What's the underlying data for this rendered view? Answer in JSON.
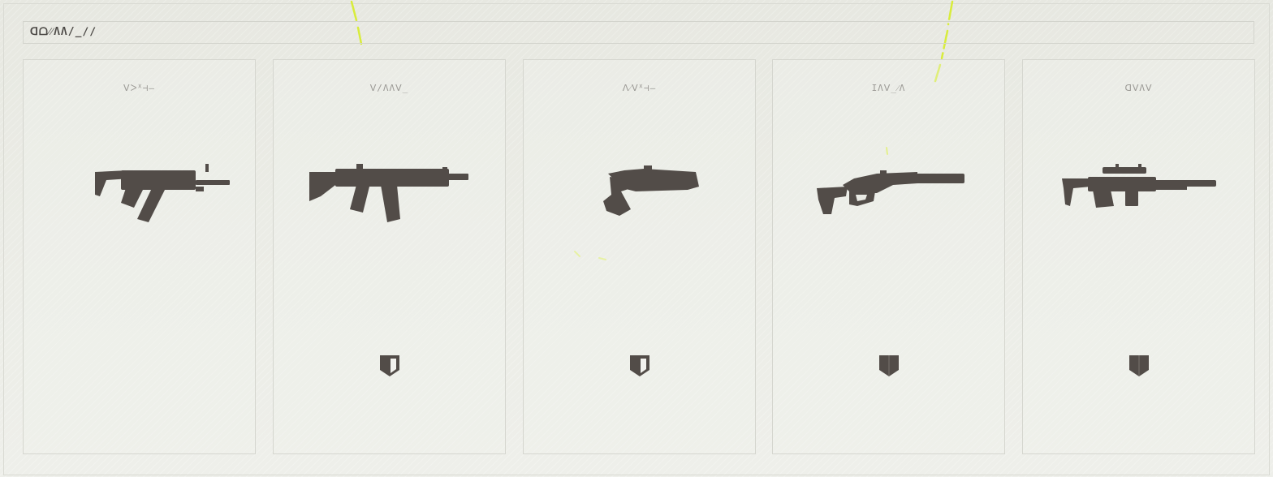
{
  "header": {
    "title_glyph": "ᗡᗝ⁄⁄ΛΛ/_∕∕"
  },
  "cards": [
    {
      "label": "ᐯᐳᕁ⊣–",
      "weapon": "smg-icon",
      "shield": "none"
    },
    {
      "label": "ᐯ/ΛΛᐯ_",
      "weapon": "assault-rifle-icon",
      "shield": "half"
    },
    {
      "label": "ᐱ⁄ᐯᕁ⊣–",
      "weapon": "pistol-icon",
      "shield": "half"
    },
    {
      "label": "ΙΛᐯ_⁄Λ",
      "weapon": "bolt-rifle-icon",
      "shield": "full"
    },
    {
      "label": "ᗡᐯΛᐯ",
      "weapon": "sniper-rifle-icon",
      "shield": "full"
    }
  ],
  "colors": {
    "background": "#e9eae4",
    "silhouette": "#524c48",
    "accent_glitch": "#d7ec3a",
    "panel_border": "#d5d6cf"
  }
}
